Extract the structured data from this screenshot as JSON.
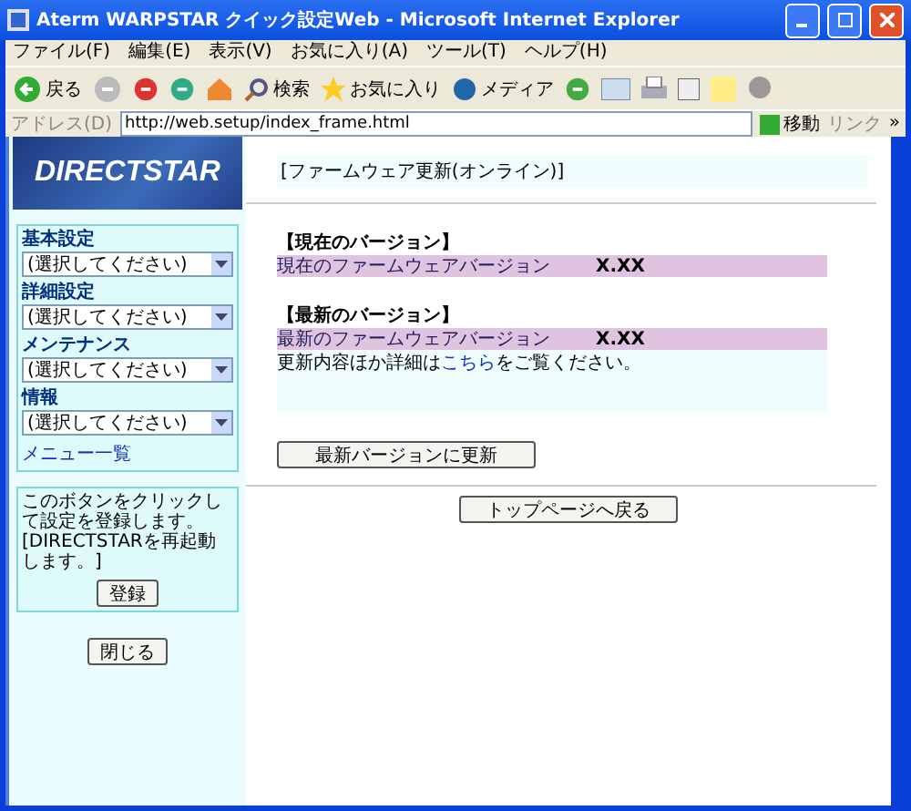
{
  "window": {
    "title": "Aterm WARPSTAR クイック設定Web - Microsoft Internet Explorer"
  },
  "menu": [
    "ファイル(F)",
    "編集(E)",
    "表示(V)",
    "お気に入り(A)",
    "ツール(T)",
    "ヘルプ(H)"
  ],
  "toolbar": {
    "back": "戻る",
    "search": "検索",
    "favorites": "お気に入り",
    "media": "メディア"
  },
  "address": {
    "label": "アドレス(D)",
    "url": "http://web.setup/index_frame.html",
    "go": "移動",
    "links": "リンク",
    "more": "»"
  },
  "sidebar": {
    "logo": "DIRECTSTAR",
    "groups": [
      {
        "label": "基本設定",
        "select": "(選択してください)"
      },
      {
        "label": "詳細設定",
        "select": "(選択してください)"
      },
      {
        "label": "メンテナンス",
        "select": "(選択してください)"
      },
      {
        "label": "情報",
        "select": "(選択してください)"
      }
    ],
    "menu_link": "メニュー一覧",
    "note": "このボタンをクリックして設定を登録します。[DIRECTSTARを再起動します。]",
    "register_button": "登録",
    "close_button": "閉じる"
  },
  "main": {
    "title": "[ファームウェア更新(オンライン)]",
    "sections": [
      {
        "heading": "【現在のバージョン】",
        "label": "現在のファームウェアバージョン",
        "value": "X.XX"
      },
      {
        "heading": "【最新のバージョン】",
        "label": "最新のファームウェアバージョン",
        "value": "X.XX"
      }
    ],
    "info": {
      "before": "更新内容ほか詳細は",
      "link": "こちら",
      "after": "をご覧ください。"
    },
    "update_button": "最新バージョンに更新",
    "top_button": "トップページへ戻る"
  }
}
